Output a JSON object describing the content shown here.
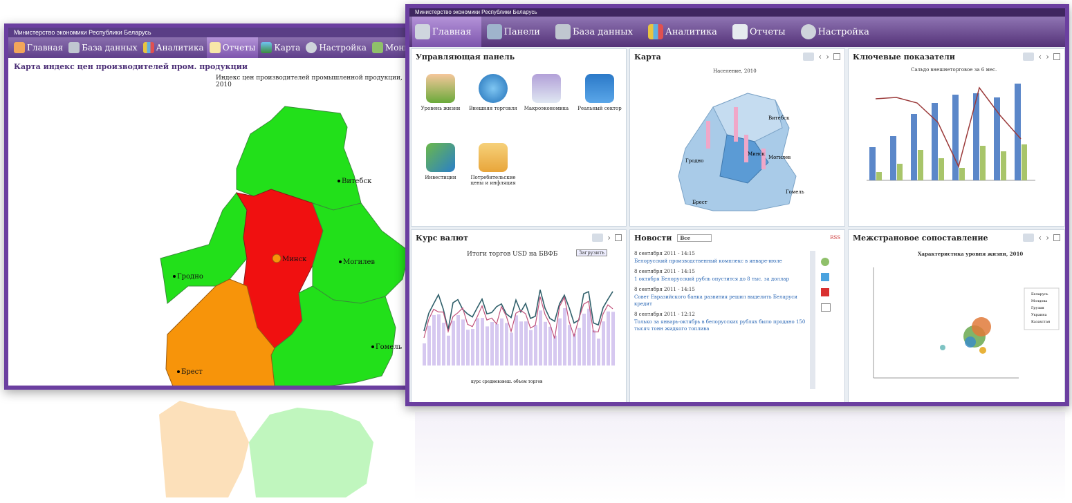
{
  "left_window": {
    "title": "Министерство экономики Республики Беларусь",
    "nav": [
      {
        "label": "Главная",
        "icon": "home-icon"
      },
      {
        "label": "База данных",
        "icon": "database-icon"
      },
      {
        "label": "Аналитика",
        "icon": "bar-chart-icon"
      },
      {
        "label": "Отчеты",
        "icon": "document-icon",
        "active": true
      },
      {
        "label": "Карта",
        "icon": "map-icon"
      },
      {
        "label": "Настройка",
        "icon": "gear-icon"
      },
      {
        "label": "Мониторинг регионов",
        "icon": "monitor-icon"
      }
    ],
    "report_title": "Карта индекс цен производителей пром. продукции",
    "map_caption": "Индекс цен производителей промышленной продукции, 2010",
    "cities": [
      "Витебск",
      "Минск",
      "Могилев",
      "Гродно",
      "Гомель",
      "Брест"
    ],
    "region_colors": {
      "green": "#22e01a",
      "red": "#f01010",
      "orange": "#f7940a"
    }
  },
  "right_window": {
    "title": "Министерство экономики Республики Беларусь",
    "nav": [
      {
        "label": "Главная",
        "icon": "home-icon",
        "active": true
      },
      {
        "label": "Панели",
        "icon": "panels-icon"
      },
      {
        "label": "База данных",
        "icon": "database-icon"
      },
      {
        "label": "Аналитика",
        "icon": "bar-chart-icon"
      },
      {
        "label": "Отчеты",
        "icon": "document-icon"
      },
      {
        "label": "Настройка",
        "icon": "gear-icon"
      }
    ],
    "panels": {
      "control": {
        "title": "Управляющая панель",
        "tiles": [
          "Уровень жизни",
          "Внешняя торговля",
          "Макроэкономика",
          "Реальный сектор",
          "Инвестиции",
          "Потребительские цены и инфляция"
        ]
      },
      "map": {
        "title": "Карта",
        "caption": "Население, 2010",
        "cities": [
          "Витебск",
          "Гродно",
          "Минск",
          "Могилев",
          "Гомель",
          "Брест"
        ]
      },
      "key": {
        "title": "Ключевые показатели",
        "chart_title": "Сальдо внешнеторговое за 6 мес."
      },
      "currency": {
        "title": "Курс валют",
        "chart_title": "Итоги торгов USD на БВФБ",
        "button": "Загрузить",
        "legend": [
          "курс",
          "средневзвеш.",
          "объем торгов"
        ]
      },
      "news": {
        "title": "Новости",
        "select": "Все",
        "rss": "RSS",
        "items": [
          {
            "date": "8 сентября 2011 - 14:15",
            "text": "Белорусский производственный комплекс в январе-июле"
          },
          {
            "date": "8 сентября 2011 - 14:15",
            "text": "1 октября Белорусский рубль опустится до 8 тыс. за доллар"
          },
          {
            "date": "8 сентября 2011 - 14:15",
            "text": "Совет Евразийского банка развития решил выделить Беларуси кредит"
          },
          {
            "date": "8 сентября 2011 - 12:12",
            "text": "Только за январь-октябрь в белорусских рублях было продано 150 тысяч тонн жидкого топлива"
          }
        ]
      },
      "compare": {
        "title": "Межстрановое сопоставление",
        "chart_title": "Характеристика уровня жизни, 2010",
        "legend": [
          "Беларусь",
          "Молдова",
          "Грузия",
          "Украина",
          "Казахстан"
        ]
      }
    }
  },
  "colors": {
    "frame": "#6b3fa0",
    "nav_dark": "#543278",
    "nav_light": "#8f75b3",
    "link": "#2a67b5"
  }
}
